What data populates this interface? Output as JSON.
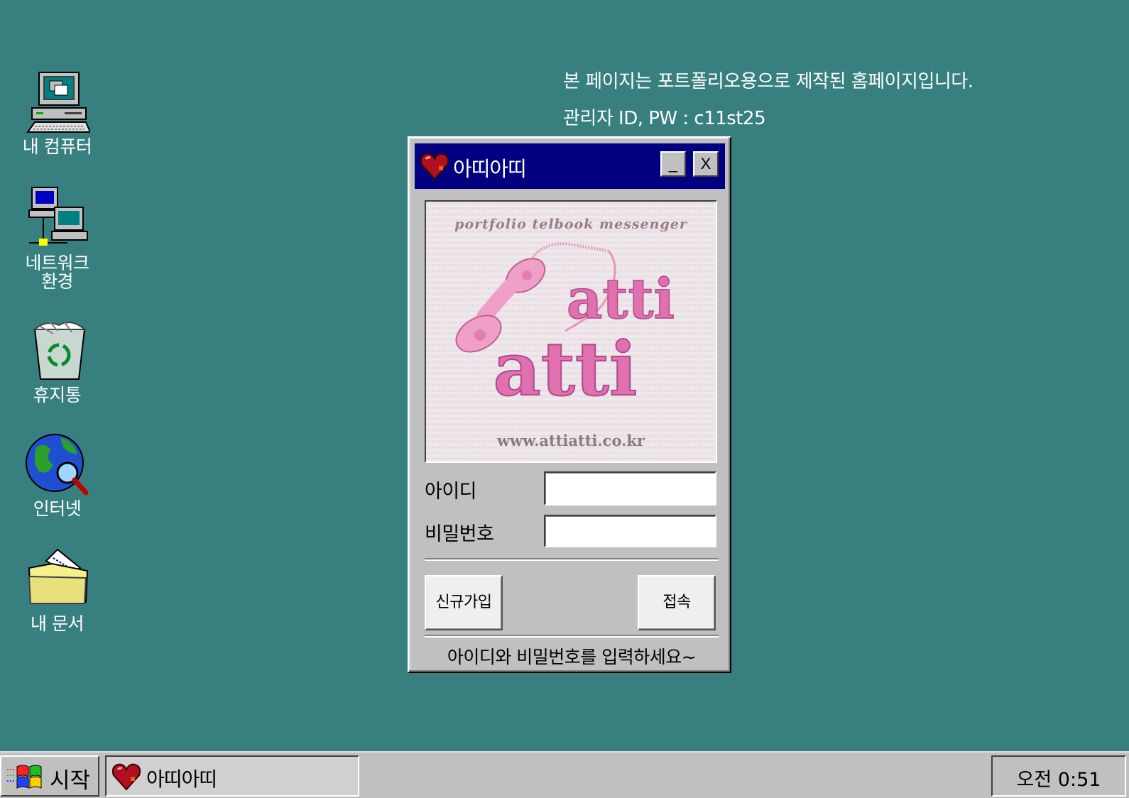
{
  "notice": {
    "line1": "본 페이지는 포트폴리오용으로 제작된 홈페이지입니다.",
    "line2": "관리자 ID, PW : c11st25"
  },
  "desktop_icons": [
    {
      "label": "내 컴퓨터",
      "icon": "my-computer-icon"
    },
    {
      "label": "네트워크\n환경",
      "icon": "network-icon"
    },
    {
      "label": "휴지통",
      "icon": "recycle-bin-icon"
    },
    {
      "label": "인터넷",
      "icon": "internet-icon"
    },
    {
      "label": "내 문서",
      "icon": "my-documents-icon"
    }
  ],
  "window": {
    "title": "아띠아띠",
    "minimize_label": "_",
    "close_label": "X",
    "banner": {
      "tagline": "portfolio telbook messenger",
      "logo_line1": "atti",
      "logo_line2": "atti",
      "url": "www.attiatti.co.kr"
    },
    "id_label": "아이디",
    "id_value": "",
    "pw_label": "비밀번호",
    "pw_value": "",
    "join_button": "신규가입",
    "login_button": "접속",
    "status": "아이디와 비밀번호를 입력하세요~"
  },
  "taskbar": {
    "start_label": "시작",
    "task_label": "아띠아띠",
    "clock": "오전 0:51"
  },
  "colors": {
    "desktop": "#388080",
    "titlebar": "#000080",
    "face": "#c0c0c0",
    "logo_pink": "#e070b0"
  }
}
